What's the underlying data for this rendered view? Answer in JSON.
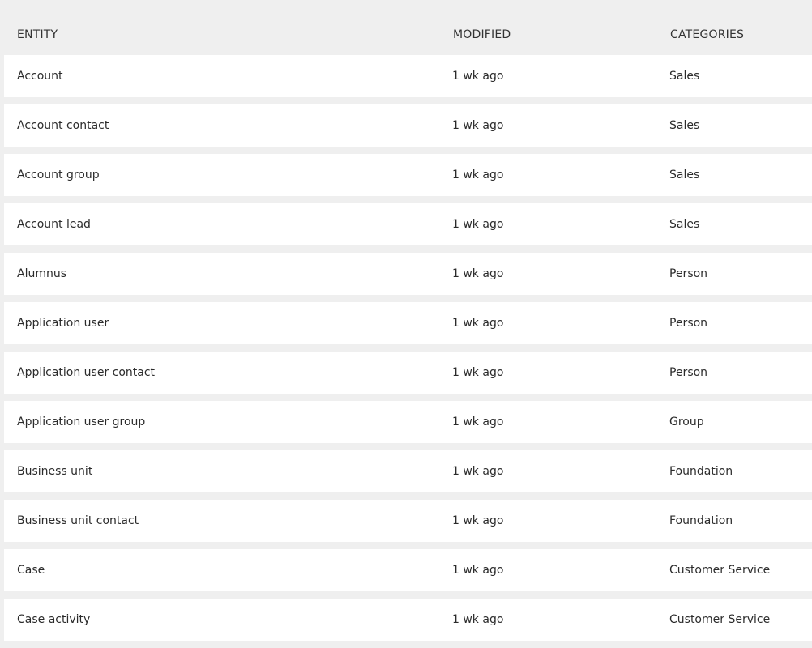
{
  "table": {
    "columns": {
      "entity": "ENTITY",
      "modified": "MODIFIED",
      "categories": "CATEGORIES"
    },
    "rows": [
      {
        "entity": "Account",
        "modified": "1 wk ago",
        "category": "Sales"
      },
      {
        "entity": "Account contact",
        "modified": "1 wk ago",
        "category": "Sales"
      },
      {
        "entity": "Account group",
        "modified": "1 wk ago",
        "category": "Sales"
      },
      {
        "entity": "Account lead",
        "modified": "1 wk ago",
        "category": "Sales"
      },
      {
        "entity": "Alumnus",
        "modified": "1 wk ago",
        "category": "Person"
      },
      {
        "entity": "Application user",
        "modified": "1 wk ago",
        "category": "Person"
      },
      {
        "entity": "Application user contact",
        "modified": "1 wk ago",
        "category": "Person"
      },
      {
        "entity": "Application user group",
        "modified": "1 wk ago",
        "category": "Group"
      },
      {
        "entity": "Business unit",
        "modified": "1 wk ago",
        "category": "Foundation"
      },
      {
        "entity": "Business unit contact",
        "modified": "1 wk ago",
        "category": "Foundation"
      },
      {
        "entity": "Case",
        "modified": "1 wk ago",
        "category": "Customer Service"
      },
      {
        "entity": "Case activity",
        "modified": "1 wk ago",
        "category": "Customer Service"
      }
    ]
  }
}
